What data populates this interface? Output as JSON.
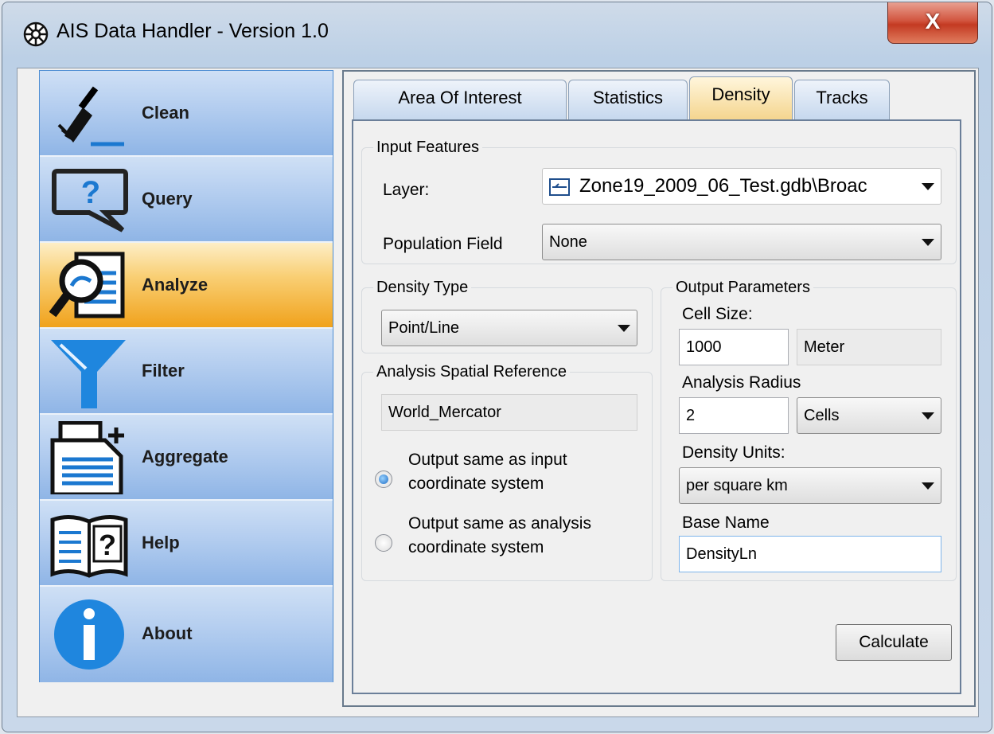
{
  "window": {
    "title": "AIS Data Handler - Version 1.0",
    "close_label": "X"
  },
  "sidebar": {
    "items": [
      {
        "label": "Clean"
      },
      {
        "label": "Query"
      },
      {
        "label": "Analyze",
        "active": true
      },
      {
        "label": "Filter"
      },
      {
        "label": "Aggregate"
      },
      {
        "label": "Help"
      },
      {
        "label": "About"
      }
    ]
  },
  "tabs": [
    {
      "label": "Area Of Interest"
    },
    {
      "label": "Statistics"
    },
    {
      "label": "Density",
      "active": true
    },
    {
      "label": "Tracks"
    }
  ],
  "density": {
    "input_features": {
      "legend": "Input Features",
      "layer_label": "Layer:",
      "layer_value": "Zone19_2009_06_Test.gdb\\Broac",
      "population_label": "Population Field",
      "population_value": "None"
    },
    "density_type": {
      "legend": "Density Type",
      "value": "Point/Line"
    },
    "spatial_ref": {
      "legend": "Analysis Spatial Reference",
      "value": "World_Mercator",
      "option1_line1": "Output same as input",
      "option1_line2": "coordinate system",
      "option2_line1": "Output same as analysis",
      "option2_line2": "coordinate system"
    },
    "output": {
      "legend": "Output Parameters",
      "cell_size_label": "Cell Size:",
      "cell_size_value": "1000",
      "cell_size_unit": "Meter",
      "radius_label": "Analysis Radius",
      "radius_value": "2",
      "radius_unit": "Cells",
      "units_label": "Density Units:",
      "units_value": "per square km",
      "basename_label": "Base Name",
      "basename_value": "DensityLn"
    },
    "calculate_label": "Calculate"
  },
  "colors": {
    "accent_active": "#f0a21c",
    "nav_blue": "#8fb5e6",
    "close_red": "#c33a22"
  }
}
